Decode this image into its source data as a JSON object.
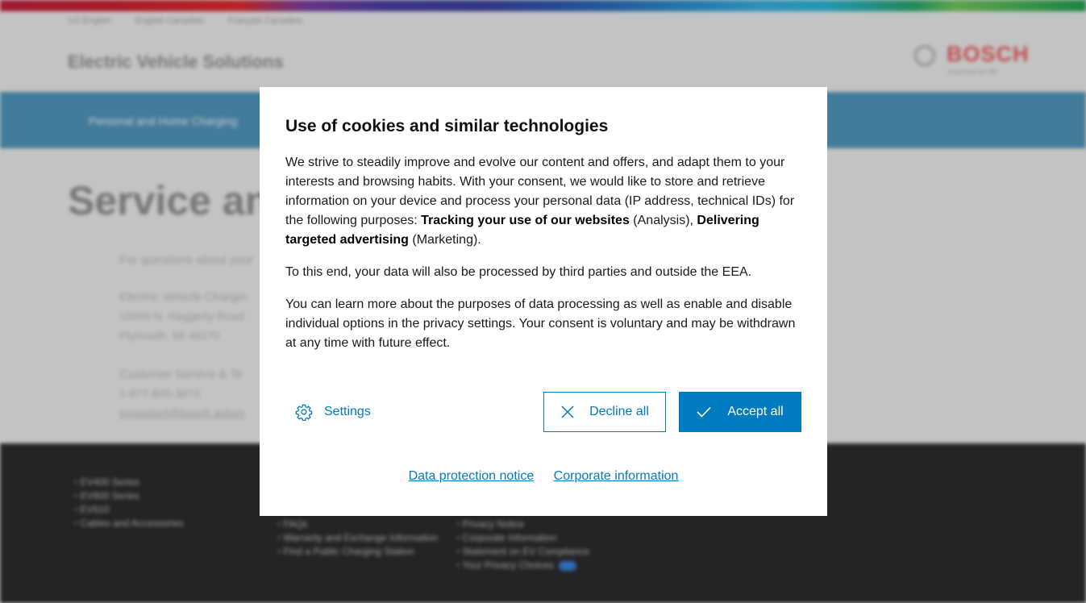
{
  "background": {
    "site_title": "Electric Vehicle Solutions",
    "lang_links": [
      "US English",
      "English Canadian",
      "Français Canadien"
    ],
    "logo_word": "BOSCH",
    "logo_tagline": "Invented for life",
    "nav_item": "Personal and Home Charging",
    "page_heading": "Service and Support",
    "content_lines": [
      "For questions about your",
      "Electric Vehicle Chargin",
      "15000 N. Haggerty Road",
      "Plymouth, MI 48170",
      "Customer Service & Te",
      "1-877-805-3873",
      "evsupport@bosch.autom"
    ],
    "footer_col1": [
      "EV400 Series",
      "EV800 Series",
      "EV610",
      "Cables and Accessories"
    ],
    "footer_col2": [
      "FAQs",
      "Warranty and Exchange Information",
      "Find a Public Charging Station"
    ],
    "footer_col3": [
      "Privacy Notice",
      "Corporate Information",
      "Statement on EV Compliance",
      "Your Privacy Choices"
    ]
  },
  "dialog": {
    "title": "Use of cookies and similar technologies",
    "p1_part1": "We strive to steadily improve and evolve our content and offers, and adapt them to your interests and browsing habits. With your consent, we would like to store and retrieve information on your device and process your personal data (IP address, technical IDs) for the following purposes: ",
    "p1_bold1": "Tracking your use of our websites",
    "p1_part2": " (Analysis), ",
    "p1_bold2": "Delivering targeted advertising",
    "p1_part3": " (Marketing).",
    "p2": "To this end, your data will also be processed by third parties and outside the EEA.",
    "p3": "You can learn more about the purposes of data processing as well as enable and disable individual options in the privacy settings. Your consent is voluntary and may be withdrawn at any time with future effect.",
    "settings_label": "Settings",
    "decline_label": "Decline all",
    "accept_label": "Accept all",
    "link_data_protection": "Data protection notice",
    "link_corporate": "Corporate information"
  },
  "colors": {
    "accent": "#007bc0",
    "footer_bg": "#2a2a2c",
    "nav_band": "#4e91b5"
  },
  "icons": {
    "settings": "gear-icon",
    "decline": "close-icon",
    "accept": "checkmark-icon"
  }
}
